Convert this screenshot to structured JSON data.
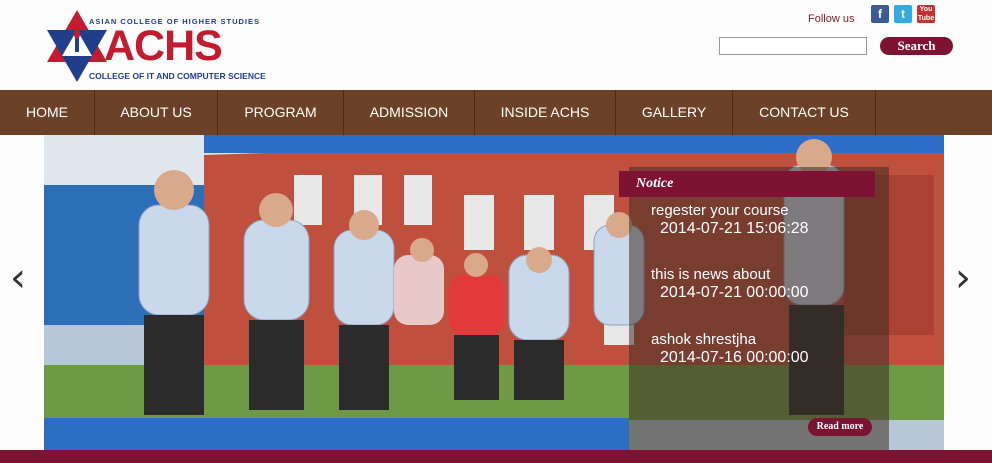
{
  "logo": {
    "top_text": "ASIAN COLLEGE OF HIGHER STUDIES",
    "brand": "ACHS",
    "bottom_text": "COLLEGE OF IT AND COMPUTER SCIENCE"
  },
  "header": {
    "follow_label": "Follow us",
    "social": [
      {
        "name": "facebook",
        "glyph": "f"
      },
      {
        "name": "twitter",
        "glyph": "t"
      },
      {
        "name": "youtube",
        "glyph": "You Tube"
      }
    ],
    "search": {
      "value": "",
      "placeholder": "",
      "button_label": "Search"
    }
  },
  "nav": {
    "items": [
      {
        "label": "HOME"
      },
      {
        "label": "ABOUT US"
      },
      {
        "label": "PROGRAM"
      },
      {
        "label": "ADMISSION"
      },
      {
        "label": "INSIDE ACHS"
      },
      {
        "label": "GALLERY"
      },
      {
        "label": "CONTACT US"
      }
    ]
  },
  "notice": {
    "title": "Notice",
    "items": [
      {
        "title": "regester your course",
        "date": "2014-07-21 15:06:28"
      },
      {
        "title": "this is news about",
        "date": "2014-07-21 00:00:00"
      },
      {
        "title": "ashok shrestjha",
        "date": "2014-07-16 00:00:00"
      }
    ],
    "read_more": "Read more"
  },
  "slider": {
    "prev": "‹",
    "next": "›"
  },
  "colors": {
    "nav_bg": "#6b4228",
    "accent": "#7d1232",
    "brand_red": "#c51b2e",
    "brand_blue": "#1f3e8c"
  }
}
